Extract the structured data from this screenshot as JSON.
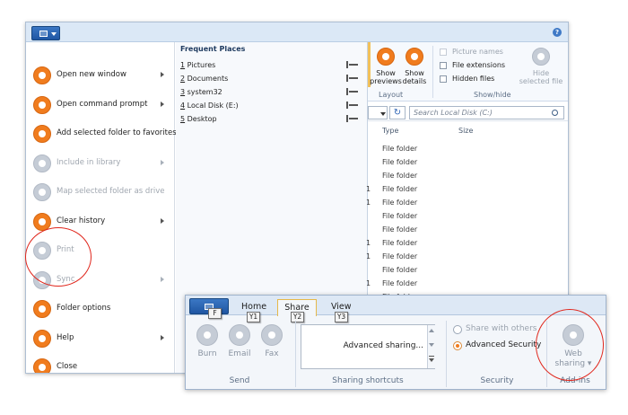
{
  "back_window": {
    "menu_items": [
      {
        "label": "Open new window",
        "enabled": true,
        "submenu": true
      },
      {
        "label": "Open command prompt",
        "enabled": true,
        "submenu": true
      },
      {
        "label": "Add selected folder to favorites",
        "enabled": true,
        "submenu": false
      },
      {
        "label": "Include in library",
        "enabled": false,
        "submenu": true
      },
      {
        "label": "Map selected folder as drive",
        "enabled": false,
        "submenu": false
      },
      {
        "label": "Clear history",
        "enabled": true,
        "submenu": true
      },
      {
        "label": "Print",
        "enabled": false,
        "submenu": false
      },
      {
        "label": "Sync",
        "enabled": false,
        "submenu": true
      },
      {
        "label": "Folder options",
        "enabled": true,
        "submenu": false
      },
      {
        "label": "Help",
        "enabled": true,
        "submenu": true
      },
      {
        "label": "Close",
        "enabled": true,
        "submenu": false
      }
    ],
    "frequent_places": {
      "header": "Frequent Places",
      "items": [
        {
          "num": "1",
          "label": "Pictures"
        },
        {
          "num": "2",
          "label": "Documents"
        },
        {
          "num": "3",
          "label": "system32"
        },
        {
          "num": "4",
          "label": "Local Disk (E:)"
        },
        {
          "num": "5",
          "label": "Desktop"
        }
      ]
    },
    "ribbon": {
      "show_previews": [
        "Show",
        "previews"
      ],
      "show_details": [
        "Show",
        "details"
      ],
      "layout_group": "Layout",
      "checkboxes": [
        {
          "label": "Picture names",
          "checked": false,
          "enabled": false
        },
        {
          "label": "File extensions",
          "checked": false,
          "enabled": true
        },
        {
          "label": "Hidden files",
          "checked": false,
          "enabled": true
        }
      ],
      "hide_selected": [
        "Hide",
        "selected file"
      ],
      "show_hide_group": "Show/hide"
    },
    "search_placeholder": "Search Local Disk (C:)",
    "columns": {
      "type": "Type",
      "size": "Size"
    },
    "rows": [
      "File folder",
      "File folder",
      "File folder",
      "File folder",
      "File folder",
      "File folder",
      "File folder",
      "File folder",
      "File folder",
      "File folder",
      "File folder",
      "File folder",
      "File folder"
    ],
    "row_ticks": [
      "",
      "",
      "",
      "1",
      "1",
      "",
      "",
      "1",
      "1",
      "",
      "1",
      "",
      ""
    ]
  },
  "front_window": {
    "tabs": [
      {
        "label": "Home",
        "keytip": "Y1",
        "selected": false
      },
      {
        "label": "Share",
        "keytip": "Y2",
        "selected": true
      },
      {
        "label": "View",
        "keytip": "Y3",
        "selected": false
      }
    ],
    "app_keytip": "F",
    "send_buttons": [
      "Burn",
      "Email",
      "Fax"
    ],
    "send_group": "Send",
    "sharing_item": "Advanced sharing...",
    "sharing_group": "Sharing shortcuts",
    "security_options": [
      {
        "label": "Share with others",
        "selected": false,
        "enabled": false
      },
      {
        "label": "Advanced Security",
        "selected": true,
        "enabled": true
      }
    ],
    "security_group": "Security",
    "web_sharing": [
      "Web",
      "sharing"
    ],
    "addins_group": "Add-ins"
  },
  "colors": {
    "accent_orange": "#f07c1e",
    "highlight_red": "#e0261c",
    "title_blue": "#1f56a3"
  }
}
